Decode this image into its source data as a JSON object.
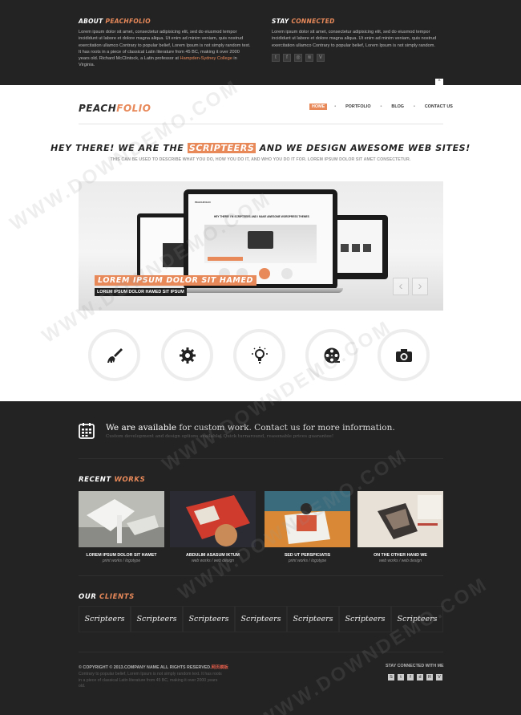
{
  "top_panel": {
    "about": {
      "title_main": "ABOUT",
      "title_accent": "PEACHFOLIO",
      "text": "Lorem ipsum dolor sit amet, consectetur adipisicing elit, sed do eiusmod tempor incididunt ut labore et dolore magna aliqua. Ut enim ad minim veniam, quis nostrud exercitation ullamco Contrary to popular belief, Lorem Ipsum is not simply random text. It has roots in a piece of classical Latin literature from 45 BC, making it over 2000 years old. Richard McClintock, a Latin professor at ",
      "link_text": "Hampden-Sydney College",
      "text_end": " in Virginia."
    },
    "stay": {
      "title_main": "STAY",
      "title_accent": "CONNECTED",
      "text": "Lorem ipsum dolor sit amet, consectetur adipisicing elit, sed do eiusmod tempor incididunt ut labore et dolore magna aliqua. Ut enim ad minim veniam, quis nostrud exercitation ullamco Contrary to popular belief, Lorem Ipsum is not simply random.",
      "social_icons": [
        "twitter-icon",
        "facebook-icon",
        "dribbble-icon",
        "rss-icon",
        "vimeo-icon"
      ]
    },
    "toggle_glyph": "^"
  },
  "header": {
    "logo_main": "PEACH",
    "logo_accent": "FOLIO",
    "nav": [
      {
        "label": "HOME",
        "active": true
      },
      {
        "label": "PORTFOLIO"
      },
      {
        "label": "BLOG"
      },
      {
        "label": "CONTACT US"
      }
    ]
  },
  "intro": {
    "headline_a": "HEY THERE! WE ARE THE ",
    "headline_hl": "SCRIPTEERS",
    "headline_b": " AND WE DESIGN AWESOME WEB SITES!",
    "sub": "THIS CAN BE USED TO DESCRIBE WHAT YOU DO, HOW YOU DO IT, AND WHO YOU DO IT FOR. LOREM IPSUM DOLOR SIT AMET CONSECTETUR."
  },
  "slider": {
    "caption": "LOREM IPSUM DOLOR SIT HAMED",
    "sub": "LOREM IPSUM DOLOR HAMED SIT IPSUM",
    "mock_logo": "PEACHFOLIO",
    "mock_headline": "HEY THERE! I'M SCRIPTEERS AND I MAKE AWESOME WORDPRESS THEMES",
    "prev": "‹",
    "next": "›"
  },
  "services": [
    "brush-icon",
    "gear-icon",
    "bulb-icon",
    "film-icon",
    "camera-icon"
  ],
  "available": {
    "strong": "We are available",
    "rest": " for custom work. Contact us for more information.",
    "sub": "Custom development and design options available! Quick turnaround, reasonable prices guarantee!"
  },
  "recent": {
    "title_main": "RECENT",
    "title_accent": "WORKS",
    "items": [
      {
        "title": "LOREM IPSUM DOLOR SIT HAMET",
        "cat": "print works / logotype"
      },
      {
        "title": "ABDULIM ASASUM IKTUM",
        "cat": "web works / web design"
      },
      {
        "title": "SED UT PERSPICIATIS",
        "cat": "print works / logotype"
      },
      {
        "title": "ON THE OTHER HAND WE",
        "cat": "web works / web design"
      }
    ]
  },
  "clients": {
    "title_main": "OUR",
    "title_accent": "CLIENTS",
    "logos": [
      "Scripteers",
      "Scripteers",
      "Scripteers",
      "Scripteers",
      "Scripteers",
      "Scripteers",
      "Scripteers"
    ]
  },
  "footer": {
    "copyright": "© COPYRIGHT © 2013.COMPANY NAME ALL RIGHTS RESERVED.",
    "copyright_red": "网页模板",
    "text": "Contrary to popular belief, Lorem Ipsum is not simply random text. It has roots in a piece of classical Latin literature from 45 BC, making it over 2000 years old.",
    "stay": "STAY CONNECTED WITH ME",
    "social": [
      "S",
      "t",
      "f",
      "d",
      "R",
      "V"
    ]
  },
  "watermark": "WWW.DOWNDEMO.COM"
}
